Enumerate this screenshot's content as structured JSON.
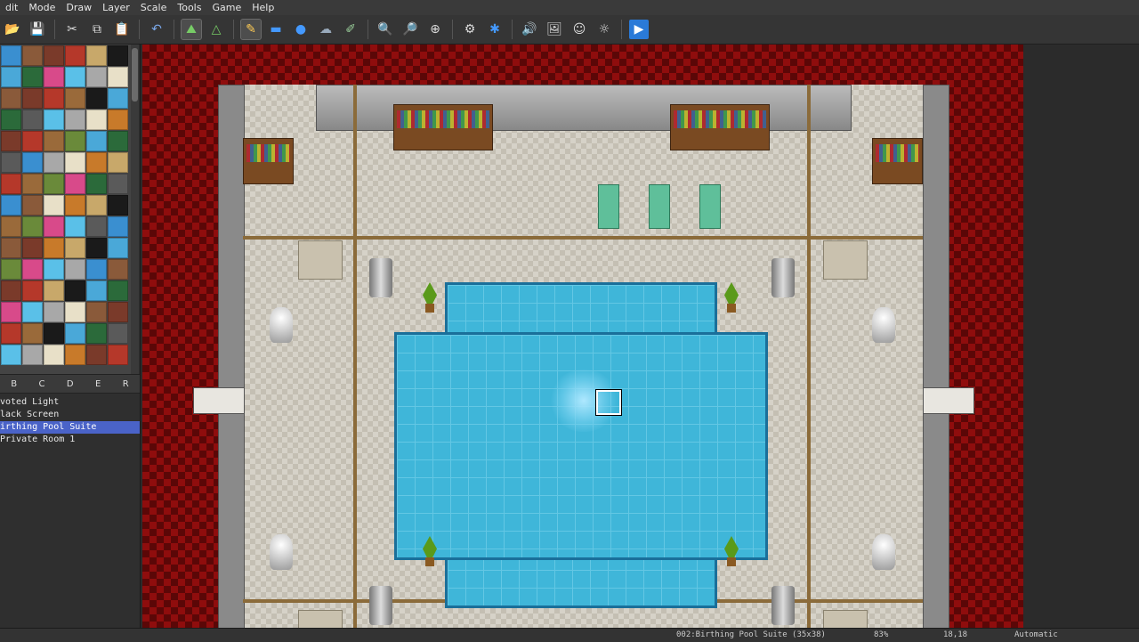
{
  "menu": [
    "Edit",
    "Mode",
    "Draw",
    "Layer",
    "Scale",
    "Tools",
    "Game",
    "Help"
  ],
  "menu_visible_labels": [
    "dit",
    "Mode",
    "Draw",
    "Layer",
    "Scale",
    "Tools",
    "Game",
    "Help"
  ],
  "toolbar_icons": [
    "open-icon",
    "save-icon",
    "cut-icon",
    "copy-icon",
    "paste-icon",
    "undo-icon",
    "map-mode-icon",
    "event-mode-icon",
    "pencil-icon",
    "rectangle-icon",
    "ellipse-icon",
    "fill-icon",
    "shadow-pen-icon",
    "zoom-in-icon",
    "zoom-out-icon",
    "zoom-actual-icon",
    "database-icon",
    "plugin-icon",
    "sound-icon",
    "resource-icon",
    "character-generator-icon",
    "search-icon",
    "playtest-icon"
  ],
  "tileset_tabs": [
    "B",
    "C",
    "D",
    "E",
    "R"
  ],
  "map_list": [
    {
      "label": "voted Light",
      "selected": false
    },
    {
      "label": "lack Screen",
      "selected": false
    },
    {
      "label": "irthing Pool Suite",
      "selected": true
    },
    {
      "label": "Private Room 1",
      "selected": false
    }
  ],
  "status": {
    "map": "002:Birthing Pool Suite (35x38)",
    "zoom": "83%",
    "coords": "18,18",
    "mode": "Automatic"
  },
  "colors": {
    "selection": "#4a63c8",
    "pool": "#3fb6d9",
    "background_red": "#8f0d0d"
  }
}
